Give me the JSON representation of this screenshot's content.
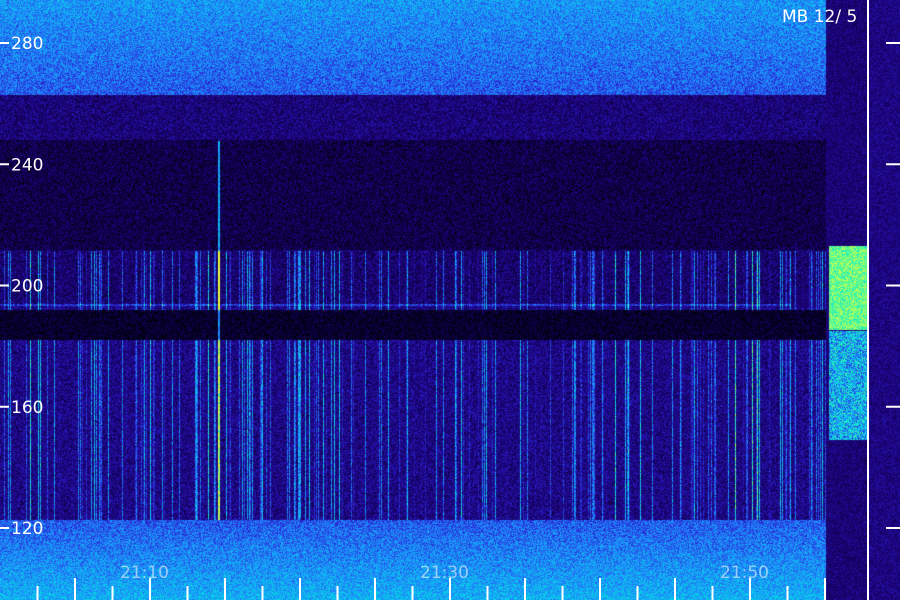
{
  "header": {
    "title": "MB 12/ 5"
  },
  "chart_data": {
    "type": "heatmap",
    "title": "MB 12/ 5",
    "xlabel": "",
    "ylabel": "",
    "y_ticks": [
      280,
      240,
      200,
      160,
      120
    ],
    "y_tick_labels": [
      "280",
      "240",
      "200",
      "160",
      "120"
    ],
    "ylim": [
      110,
      290
    ],
    "x_tick_labels": [
      "21:10",
      "21:30",
      "21:50"
    ],
    "xlim_minutes": [
      1262.5,
      1292.5
    ],
    "x_tick_minutes": [
      1270,
      1290,
      1310
    ],
    "features": [
      {
        "kind": "horizontal-band",
        "y": 196,
        "x_from": "start",
        "x_to": "21:51"
      },
      {
        "kind": "quiet-band",
        "y_from": 184,
        "y_to": 192
      },
      {
        "kind": "quiet-region",
        "y_from": 210,
        "y_to": 250
      },
      {
        "kind": "broadband-noise",
        "y_from": 260,
        "y_to": 290
      },
      {
        "kind": "broadband-noise",
        "y_from": 110,
        "y_to": 125
      },
      {
        "kind": "vertical-spikes",
        "y_from": 120,
        "y_to": 190
      }
    ],
    "colormap": [
      "#000010",
      "#1a0070",
      "#2a1fd0",
      "#1e90ff",
      "#00e0e0",
      "#50ff90",
      "#e8ff40"
    ]
  }
}
